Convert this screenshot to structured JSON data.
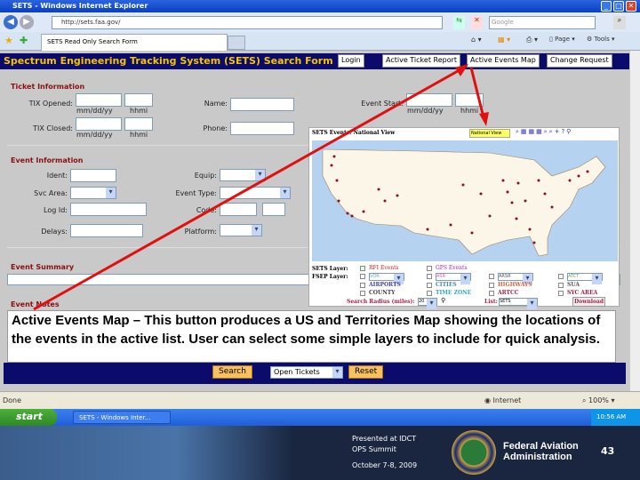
{
  "window": {
    "title": "SETS - Windows Internet Explorer",
    "address": "http://sets.faa.gov/",
    "search_placeholder": "Google",
    "tab": "SETS Read Only Search Form",
    "home": "Page",
    "tools": "Tools"
  },
  "header": {
    "title": "Spectrum Engineering Tracking System (SETS) Search Form",
    "buttons": [
      "Login",
      "Active Ticket Report",
      "Active Events Map",
      "Change Request"
    ]
  },
  "ticket": {
    "section": "Ticket Information",
    "tix_opened": "TIX Opened:",
    "tix_closed": "TIX Closed:",
    "date_hint": "mm/dd/yy",
    "time_hint": "hhmi",
    "name": "Name:",
    "phone": "Phone:",
    "event_start": "Event Start:"
  },
  "event": {
    "section": "Event Information",
    "ident": "Ident:",
    "svc_area": "Svc Area:",
    "log_id": "Log Id:",
    "delays": "Delays:",
    "equip": "Equip:",
    "event_type": "Event Type:",
    "code": "Code:",
    "platform": "Platform:"
  },
  "summary": {
    "section": "Event Summary"
  },
  "notes": {
    "section": "Event Notes"
  },
  "overlay_text": "Active Events Map – This button produces a US and Territories Map showing the locations of the events in the active list. User can select some simple layers to include for quick analysis.",
  "footer": {
    "search": "Search",
    "filter": "Open Tickets",
    "reset": "Reset"
  },
  "map": {
    "title": "SETS Events: National View",
    "view": "National View",
    "sets_layer": "SETS Layer:",
    "fsep_layer": "FSEP Layer:",
    "layers": {
      "rfi": "RFI Events",
      "gps": "GPS Events",
      "vor": "VOR",
      "asr": "ASR",
      "arsr": "ARSR",
      "atct": "ATCT",
      "airports": "AIRPORTS",
      "cities": "CITIES",
      "highways": "HIGHWAYS",
      "sua": "SUA",
      "county": "COUNTY",
      "timezone": "TIME ZONE",
      "artcc": "ARTCC",
      "syc": "SYC AREA"
    },
    "radius_label": "Search Radius (miles):",
    "radius": "20",
    "list_label": "List:",
    "list": "SETS",
    "download": "Download"
  },
  "status": {
    "text": "Done",
    "zone": "Internet",
    "zoom": "100%"
  },
  "taskbar": {
    "start": "start",
    "task": "SETS - Windows Inter...",
    "clock": "10:56 AM"
  },
  "slide": {
    "presented": "Presented at IDCT",
    "event": "OPS Summit",
    "date": "October 7-8, 2009",
    "org1": "Federal Aviation",
    "org2": "Administration",
    "page": "43"
  }
}
